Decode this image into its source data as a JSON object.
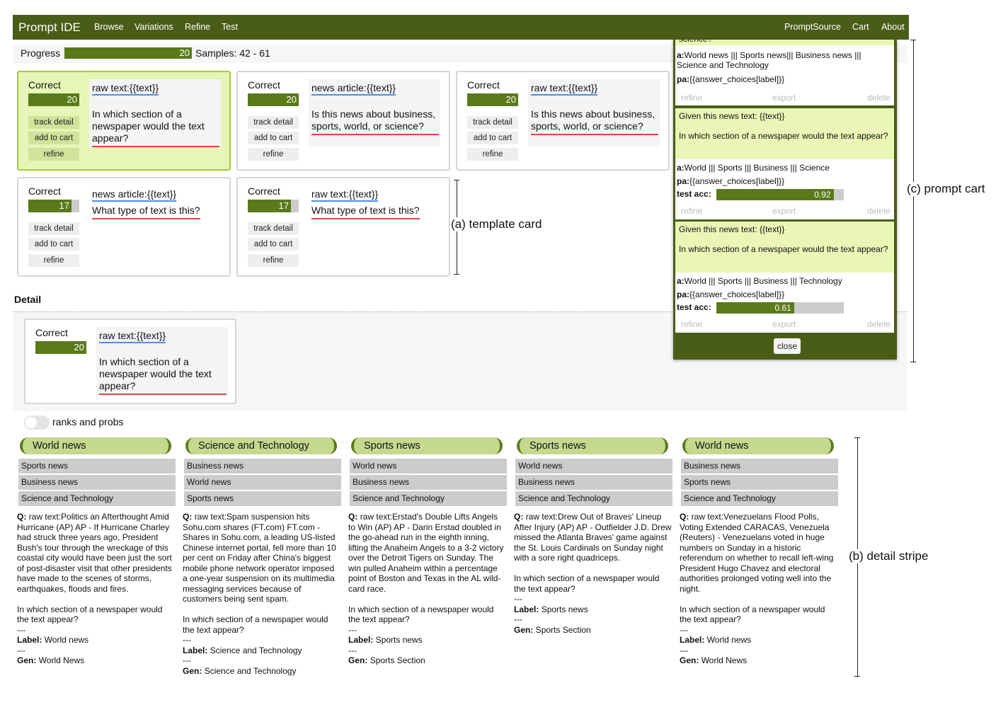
{
  "nav": {
    "brand": "Prompt IDE",
    "left": [
      "Browse",
      "Variations",
      "Refine",
      "Test"
    ],
    "right": [
      "PromptSource",
      "Cart",
      "About"
    ]
  },
  "progress": {
    "label": "Progress",
    "value": 20,
    "fraction": 1.0,
    "samples": "Samples: 42 - 61"
  },
  "cards": [
    {
      "label": "Correct",
      "score": "20",
      "fraction": 1.0,
      "prefix": "raw text:",
      "var": "{{text}}",
      "question": "In which section of a newspaper would the text appear?",
      "buttons": [
        "track detail",
        "add to cart",
        "refine"
      ],
      "selected": true
    },
    {
      "label": "Correct",
      "score": "20",
      "fraction": 1.0,
      "prefix": "news article:",
      "var": "{{text}}",
      "question": "Is this news about business, sports, world, or science?",
      "buttons": [
        "track detail",
        "add to cart",
        "refine"
      ],
      "selected": false
    },
    {
      "label": "Correct",
      "score": "20",
      "fraction": 1.0,
      "prefix": "raw text:",
      "var": "{{text}}",
      "question": "Is this news about business, sports, world, or science?",
      "buttons": [
        "track detail",
        "add to cart",
        "refine"
      ],
      "selected": false
    },
    {
      "label": "Correct",
      "score": "17",
      "fraction": 0.85,
      "prefix": "news article:",
      "var": "{{text}}",
      "question": "What type of text is this?",
      "buttons": [
        "track detail",
        "add to cart",
        "refine"
      ],
      "selected": false
    },
    {
      "label": "Correct",
      "score": "17",
      "fraction": 0.85,
      "prefix": "raw text:",
      "var": "{{text}}",
      "question": "What type of text is this?",
      "buttons": [
        "track detail",
        "add to cart",
        "refine"
      ],
      "selected": false
    }
  ],
  "annotations": {
    "template_card": "(a) template card",
    "prompt_cart": "(c) prompt cart",
    "detail_stripe": "(b) detail stripe"
  },
  "detail": {
    "heading": "Detail",
    "card": {
      "label": "Correct",
      "score": "20",
      "fraction": 1.0,
      "prefix": "raw text:",
      "var": "{{text}}",
      "question": "In which section of a newspaper would the text appear?"
    }
  },
  "cart": {
    "items": [
      {
        "header_cut": "science?",
        "a": "World news ||| Sports news||| Business news ||| Science and Technology",
        "pa": "{{answer_choices[label]}}",
        "actions": [
          "refine",
          "export",
          "delete"
        ]
      },
      {
        "header": "Given this news text: {{text}}",
        "header2": "In which section of a newspaper would the text appear?",
        "a": "World ||| Sports ||| Business ||| Science",
        "pa": "{{answer_choices[label]}}",
        "acc_label": "test acc:",
        "acc": "0.92",
        "acc_fraction": 0.92,
        "actions": [
          "refine",
          "export",
          "delete"
        ]
      },
      {
        "header": "Given this news text: {{text}}",
        "header2": "In which section of a newspaper would the text appear?",
        "a": "World ||| Sports ||| Business ||| Technology",
        "pa": "{{answer_choices[label]}}",
        "acc_label": "test acc:",
        "acc": "0.61",
        "acc_fraction": 0.61,
        "actions": [
          "refine",
          "export",
          "delete"
        ]
      }
    ],
    "a_label": "a:",
    "pa_label": "pa:",
    "close": "close"
  },
  "toggle": {
    "label": "ranks and probs",
    "on": false
  },
  "stripe": [
    {
      "top": "World news",
      "ranks": [
        "Sports news",
        "Business news",
        "Science and Technology"
      ],
      "q": "raw text:Politics an Afterthought Amid Hurricane (AP) AP - If Hurricane Charley had struck three years ago, President Bush's tour through the wreckage of this coastal city would have been just the sort of post-disaster visit that other presidents have made to the scenes of storms, earthquakes, floods and fires.",
      "question": "In which section of a newspaper would the text appear?",
      "label": "World news",
      "gen": "World News"
    },
    {
      "top": "Science and Technology",
      "ranks": [
        "Business news",
        "World news",
        "Sports news"
      ],
      "q": "raw text:Spam suspension hits Sohu.com shares (FT.com) FT.com - Shares in Sohu.com, a leading US-listed Chinese internet portal, fell more than 10 per cent on Friday after China's biggest mobile phone network operator imposed a one-year suspension on its multimedia messaging services because of customers being sent spam.",
      "question": "In which section of a newspaper would the text appear?",
      "label": "Science and Technology",
      "gen": "Science and Technology"
    },
    {
      "top": "Sports news",
      "ranks": [
        "World news",
        "Business news",
        "Science and Technology"
      ],
      "q": "raw text:Erstad's Double Lifts Angels to Win (AP) AP - Darin Erstad doubled in the go-ahead run in the eighth inning, lifting the Anaheim Angels to a 3-2 victory over the Detroit Tigers on Sunday. The win pulled Anaheim within a percentage point of Boston and Texas in the AL wild-card race.",
      "question": "In which section of a newspaper would the text appear?",
      "label": "Sports news",
      "gen": "Sports Section"
    },
    {
      "top": "Sports news",
      "ranks": [
        "World news",
        "Business news",
        "Science and Technology"
      ],
      "q": "raw text:Drew Out of Braves' Lineup After Injury (AP) AP - Outfielder J.D. Drew missed the Atlanta Braves' game against the St. Louis Cardinals on Sunday night with a sore right quadriceps.",
      "question": "In which section of a newspaper would the text appear?",
      "label": "Sports news",
      "gen": "Sports Section"
    },
    {
      "top": "World news",
      "ranks": [
        "Business news",
        "Sports news",
        "Science and Technology"
      ],
      "q": "raw text:Venezuelans Flood Polls, Voting Extended CARACAS, Venezuela (Reuters) - Venezuelans voted in huge numbers on Sunday in a historic referendum on whether to recall left-wing President Hugo Chavez and electoral authorities prolonged voting well into the night.",
      "question": "In which section of a newspaper would the text appear?",
      "label": "World news",
      "gen": "World News"
    }
  ],
  "stripe_labels": {
    "q": "Q:",
    "sep": "---",
    "label": "Label:",
    "gen": "Gen:"
  },
  "colors": {
    "nav": "#4a5d17",
    "bar": "#5a7a1a",
    "selected_card": "#e6f6b6",
    "cart_header": "#eaf6b6",
    "rank_header": "#c5d98e"
  }
}
